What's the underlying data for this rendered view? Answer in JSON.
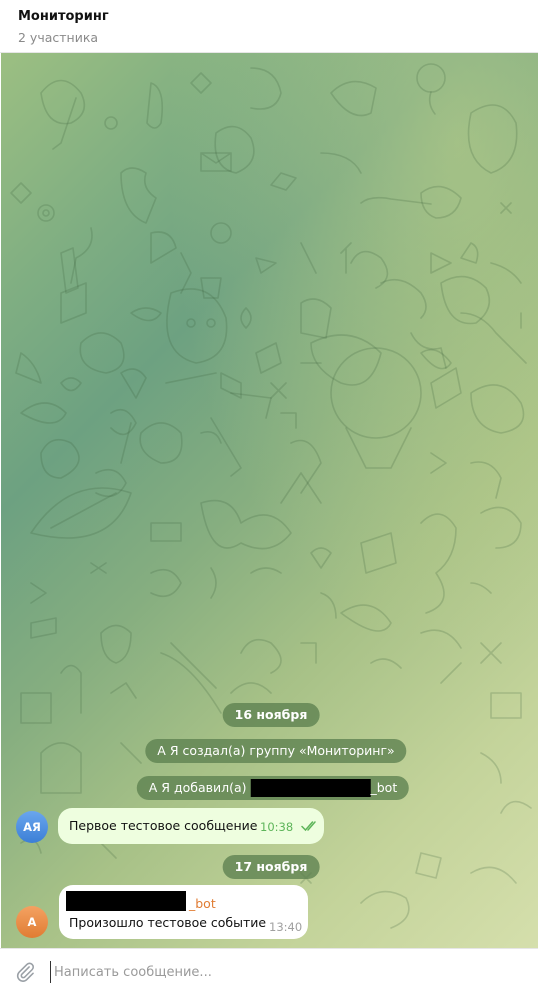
{
  "header": {
    "title": "Мониторинг",
    "subtitle": "2 участника"
  },
  "messages": {
    "date1": "16 ноября",
    "created": "А Я создал(а) группу «Мониторинг»",
    "added_prefix": "А Я добавил(а)",
    "added_suffix": "_bot",
    "first": {
      "avatar": "АЯ",
      "text": "Первое тестовое сообщение",
      "time": "10:38",
      "status_icon": "double-check-icon"
    },
    "date2": "17 ноября",
    "second": {
      "avatar": "А",
      "sender_suffix": "_bot",
      "text": "Произошло тестовое событие",
      "time": "13:40"
    }
  },
  "composer": {
    "placeholder": "Написать сообщение...",
    "attach_icon": "paperclip-icon"
  },
  "colors": {
    "outgoing_bubble": "#eefedf",
    "time_out": "#5eb55a",
    "sender_name": "#e07c33",
    "avatar_blue": "#4a8ee0",
    "avatar_orange": "#ea8c45"
  }
}
